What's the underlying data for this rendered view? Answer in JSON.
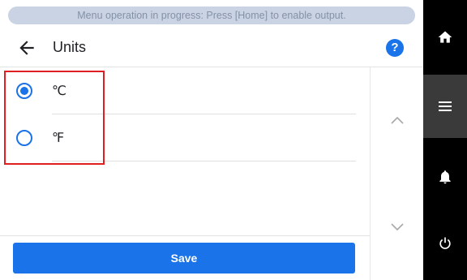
{
  "banner": {
    "text": "Menu operation in progress: Press [Home] to enable output."
  },
  "header": {
    "title": "Units",
    "help_label": "?"
  },
  "options": [
    {
      "label": "℃",
      "selected": true
    },
    {
      "label": "℉",
      "selected": false
    }
  ],
  "footer": {
    "save_label": "Save"
  },
  "icons": {
    "back": "back-arrow-icon",
    "help": "help-icon",
    "scroll_up": "chevron-up-icon",
    "scroll_down": "chevron-down-icon",
    "home": "home-icon",
    "menu": "menu-icon",
    "bell": "bell-icon",
    "power": "power-icon"
  },
  "colors": {
    "accent": "#1a73e8",
    "banner_bg": "#c9d3e4",
    "banner_text": "#8592a6",
    "highlight": "#e02020",
    "nav_bg": "#000000",
    "nav_active": "#3a3a3a"
  }
}
